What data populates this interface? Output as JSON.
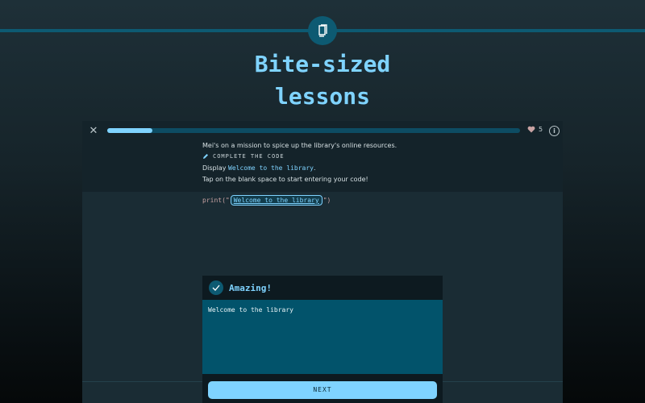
{
  "hero": {
    "line1": "Bite-sized",
    "line2": "lessons"
  },
  "icons": {
    "badge": "book-icon",
    "close": "close-icon",
    "heart": "heart-icon",
    "info": "info-icon",
    "pencil": "pencil-icon",
    "check": "check-icon"
  },
  "topbar": {
    "close_glyph": "✕",
    "progress": 0.11,
    "lives": "5",
    "info_glyph": "i"
  },
  "lesson": {
    "intro": "Mei's on a mission to spice up the library's online resources.",
    "task_label": "COMPLETE THE CODE",
    "instruction_prefix": "Display ",
    "instruction_code": "Welcome to the library",
    "instruction_suffix": ".",
    "hint": "Tap on the blank space to start entering your code!"
  },
  "code": {
    "before": "print(\"",
    "blank": "Welcome to the library",
    "after": "\")"
  },
  "feedback": {
    "title": "Amazing!",
    "output": "Welcome to the library",
    "next_label": "NEXT"
  },
  "colors": {
    "accent": "#7fd3ff",
    "brand_teal": "#0d5a72",
    "output_bg": "#02536b",
    "heart": "#c9a3a3"
  }
}
